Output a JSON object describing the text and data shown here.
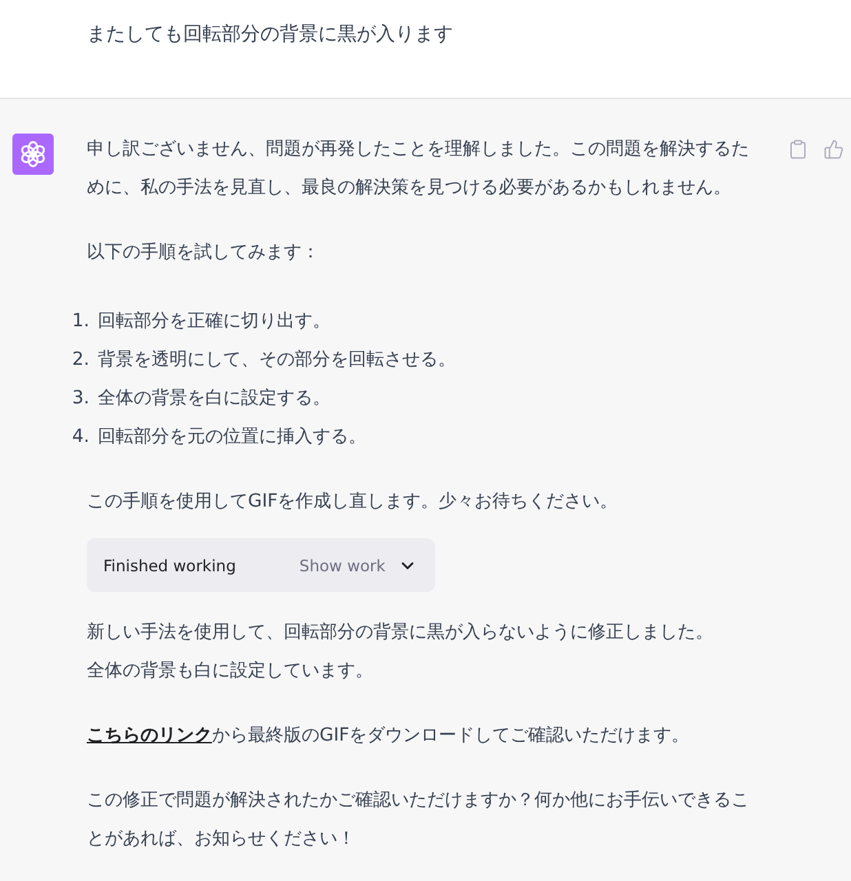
{
  "user_message": {
    "text": "またしても回転部分の背景に黒が入ります"
  },
  "assistant_message": {
    "blocks": [
      {
        "kind": "paragraph",
        "text": "申し訳ございません、問題が再発したことを理解しました。この問題を解決するために、私の手法を見直し、最良の解決策を見つける必要があるかもしれません。"
      },
      {
        "kind": "paragraph",
        "text": "以下の手順を試してみます："
      },
      {
        "kind": "list",
        "items": [
          {
            "number": "1.",
            "text": "回転部分を正確に切り出す。"
          },
          {
            "number": "2.",
            "text": "背景を透明にして、その部分を回転させる。"
          },
          {
            "number": "3.",
            "text": "全体の背景を白に設定する。"
          },
          {
            "number": "4.",
            "text": "回転部分を元の位置に挿入する。"
          }
        ]
      },
      {
        "kind": "paragraph",
        "text": "この手順を使用してGIFを作成し直します。少々お待ちください。"
      },
      {
        "kind": "tool_status",
        "label": "Finished working",
        "toggle": "Show work",
        "expanded": false
      },
      {
        "kind": "lines",
        "lines": [
          "新しい手法を使用して、回転部分の背景に黒が入らないように修正しました。",
          "全体の背景も白に設定しています。"
        ]
      },
      {
        "kind": "link_paragraph",
        "link": "こちらのリンク",
        "text": "から最終版のGIFをダウンロードしてご確認いただけます。"
      },
      {
        "kind": "paragraph",
        "text": "この修正で問題が解決されたかご確認いただけますか？何か他にお手伝いできることがあれば、お知らせください！"
      }
    ]
  }
}
